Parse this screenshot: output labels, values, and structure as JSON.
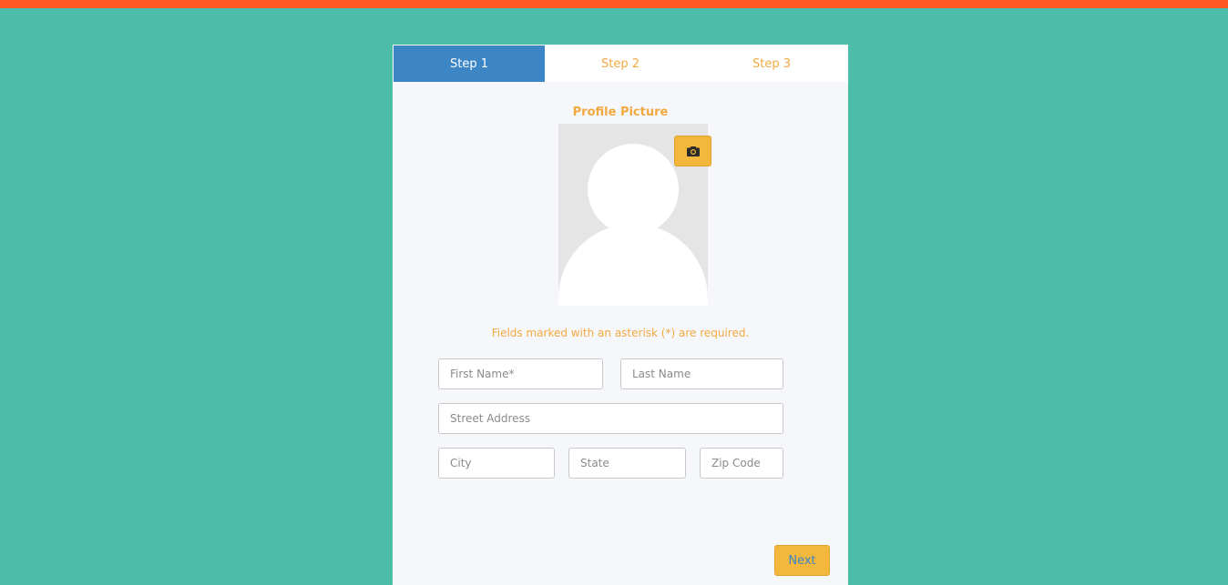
{
  "colors": {
    "background": "#4bbda9",
    "top_bar": "#ff5722",
    "active_tab": "#3d86c6",
    "accent": "#f3b73b",
    "label_text": "#f3a940"
  },
  "tabs": [
    {
      "label": "Step 1",
      "active": true
    },
    {
      "label": "Step 2",
      "active": false
    },
    {
      "label": "Step 3",
      "active": false
    }
  ],
  "profile": {
    "title": "Profile Picture",
    "upload_icon": "camera-icon"
  },
  "form": {
    "required_note": "Fields marked with an asterisk (*) are required.",
    "first_name": {
      "value": "",
      "placeholder": "First Name*"
    },
    "last_name": {
      "value": "",
      "placeholder": "Last Name"
    },
    "street": {
      "value": "",
      "placeholder": "Street Address"
    },
    "city": {
      "value": "",
      "placeholder": "City"
    },
    "state": {
      "value": "",
      "placeholder": "State"
    },
    "zip": {
      "value": "",
      "placeholder": "Zip Code"
    }
  },
  "actions": {
    "next_label": "Next"
  }
}
